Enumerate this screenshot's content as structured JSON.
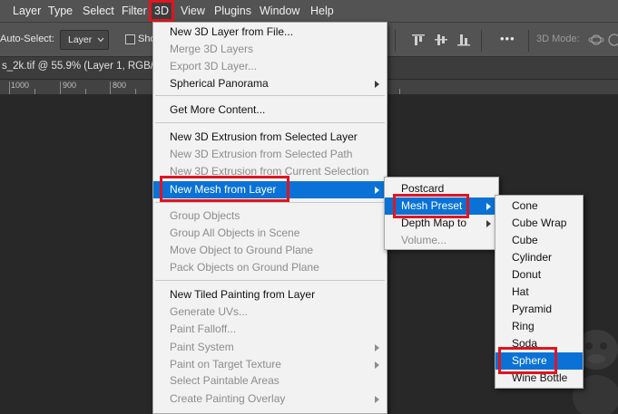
{
  "menubar": {
    "items": [
      "Layer",
      "Type",
      "Select",
      "Filter",
      "3D",
      "View",
      "Plugins",
      "Window",
      "Help"
    ]
  },
  "options_bar": {
    "auto_select_label": "Auto-Select:",
    "auto_select_value": "Layer",
    "show_label": "Sho",
    "more_label": "•••",
    "mode_label": "3D Mode:"
  },
  "document": {
    "tab_title": "s_2k.tif @ 55.9% (Layer 1, RGB/8",
    "ruler_labels": [
      "1000",
      "900",
      "800"
    ]
  },
  "menu_3d": {
    "items": [
      {
        "label": "New 3D Layer from File...",
        "enabled": true
      },
      {
        "label": "Merge 3D Layers",
        "enabled": false
      },
      {
        "label": "Export 3D Layer...",
        "enabled": false
      },
      {
        "label": "Spherical Panorama",
        "enabled": true,
        "submenu": true
      },
      {
        "label": "Get More Content...",
        "enabled": true
      },
      {
        "label": "New 3D Extrusion from Selected Layer",
        "enabled": true
      },
      {
        "label": "New 3D Extrusion from Selected Path",
        "enabled": false
      },
      {
        "label": "New 3D Extrusion from Current Selection",
        "enabled": false
      },
      {
        "label": "New Mesh from Layer",
        "enabled": true,
        "submenu": true,
        "highlighted": true
      },
      {
        "label": "Group Objects",
        "enabled": false
      },
      {
        "label": "Group All Objects in Scene",
        "enabled": false
      },
      {
        "label": "Move Object to Ground Plane",
        "enabled": false
      },
      {
        "label": "Pack Objects on Ground Plane",
        "enabled": false
      },
      {
        "label": "New Tiled Painting from Layer",
        "enabled": true
      },
      {
        "label": "Generate UVs...",
        "enabled": false
      },
      {
        "label": "Paint Falloff...",
        "enabled": false
      },
      {
        "label": "Paint System",
        "enabled": false,
        "submenu": true
      },
      {
        "label": "Paint on Target Texture",
        "enabled": false,
        "submenu": true
      },
      {
        "label": "Select Paintable Areas",
        "enabled": false
      },
      {
        "label": "Create Painting Overlay",
        "enabled": false,
        "submenu": true
      }
    ]
  },
  "menu_mesh": {
    "items": [
      {
        "label": "Postcard",
        "enabled": true
      },
      {
        "label": "Mesh Preset",
        "enabled": true,
        "submenu": true,
        "highlighted": true
      },
      {
        "label": "Depth Map to",
        "enabled": true,
        "submenu": true
      },
      {
        "label": "Volume...",
        "enabled": false
      }
    ]
  },
  "menu_preset": {
    "items": [
      {
        "label": "Cone"
      },
      {
        "label": "Cube Wrap"
      },
      {
        "label": "Cube"
      },
      {
        "label": "Cylinder"
      },
      {
        "label": "Donut"
      },
      {
        "label": "Hat"
      },
      {
        "label": "Pyramid"
      },
      {
        "label": "Ring"
      },
      {
        "label": "Soda"
      },
      {
        "label": "Sphere",
        "highlighted": true
      },
      {
        "label": "Wine Bottle"
      }
    ]
  },
  "colors": {
    "highlight": "#0a72d6",
    "annotation_red": "#e0151f",
    "menu_bg": "#f2f2f2",
    "chrome_bg": "#535353"
  },
  "icons": {
    "move_tool": "move-arrow-icon",
    "align": "align-icons",
    "orbit_3d": "orbit-3d-icon"
  }
}
